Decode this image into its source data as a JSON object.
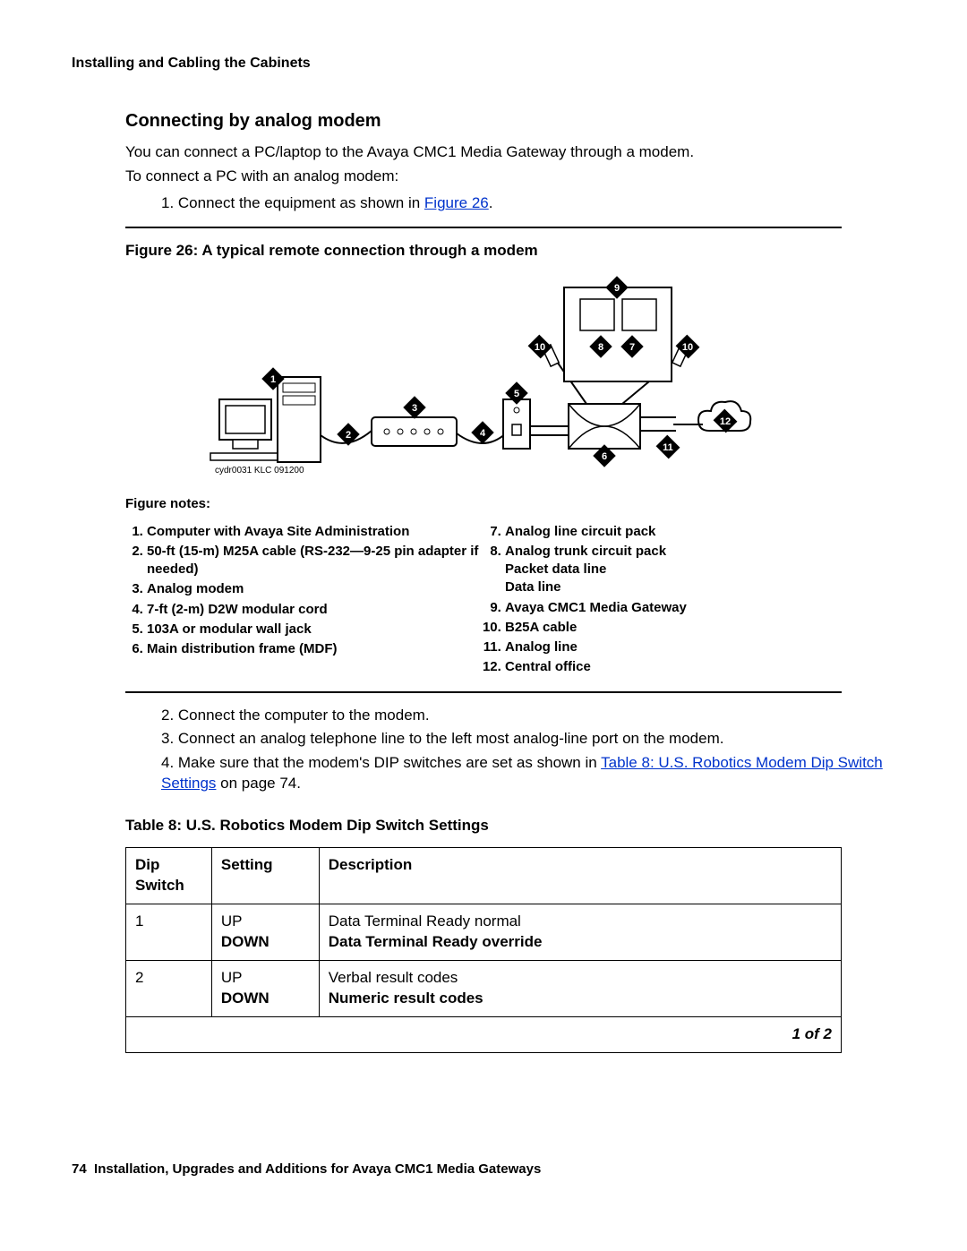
{
  "header": "Installing and Cabling the Cabinets",
  "section_title": "Connecting by analog modem",
  "intro_1": "You can connect a PC/laptop to the Avaya CMC1 Media Gateway through a modem.",
  "intro_2": "To connect a PC with an analog modem:",
  "steps": {
    "s1_pre": "1. Connect the equipment as shown in ",
    "s1_link": "Figure 26",
    "s1_post": ".",
    "s2": "2. Connect the computer to the modem.",
    "s3": "3. Connect an analog telephone line to the left most analog-line port on the modem.",
    "s4_pre": "4. Make sure that the modem's DIP switches are set as shown in ",
    "s4_link": "Table 8:  U.S. Robotics Modem Dip Switch Settings",
    "s4_post": " on page 74."
  },
  "figure_caption": "Figure 26: A typical remote connection through a modem",
  "diagram_id": "cydr0031 KLC 091200",
  "notes_title": "Figure notes:",
  "notes_left": [
    "Computer with Avaya Site Administration",
    "50-ft (15-m) M25A cable (RS-232—9-25 pin adapter if needed)",
    "Analog modem",
    "7-ft (2-m) D2W modular cord",
    "103A or modular wall jack",
    "Main distribution frame (MDF)"
  ],
  "notes_right": [
    "Analog line circuit pack",
    "Analog trunk circuit pack",
    "Avaya CMC1 Media Gateway",
    "B25A cable",
    "Analog line",
    "Central office"
  ],
  "notes_right_sub": {
    "after8_a": "Packet data line",
    "after8_b": "Data line"
  },
  "table_caption": "Table 8: U.S. Robotics Modem Dip Switch Settings",
  "table": {
    "headers": {
      "c1": "Dip Switch",
      "c2": "Setting",
      "c3": "Description"
    },
    "rows": [
      {
        "dip": "1",
        "set_a": "UP",
        "set_b": "DOWN",
        "desc_a": "Data Terminal Ready normal",
        "desc_b": "Data Terminal Ready override"
      },
      {
        "dip": "2",
        "set_a": "UP",
        "set_b": "DOWN",
        "desc_a": "Verbal result codes",
        "desc_b": "Numeric result codes"
      }
    ],
    "pager": "1 of 2"
  },
  "footer": {
    "page": "74",
    "title": "Installation, Upgrades and Additions for Avaya CMC1 Media Gateways"
  },
  "callouts": [
    "1",
    "2",
    "3",
    "4",
    "5",
    "6",
    "7",
    "8",
    "9",
    "10",
    "10",
    "11",
    "12"
  ]
}
